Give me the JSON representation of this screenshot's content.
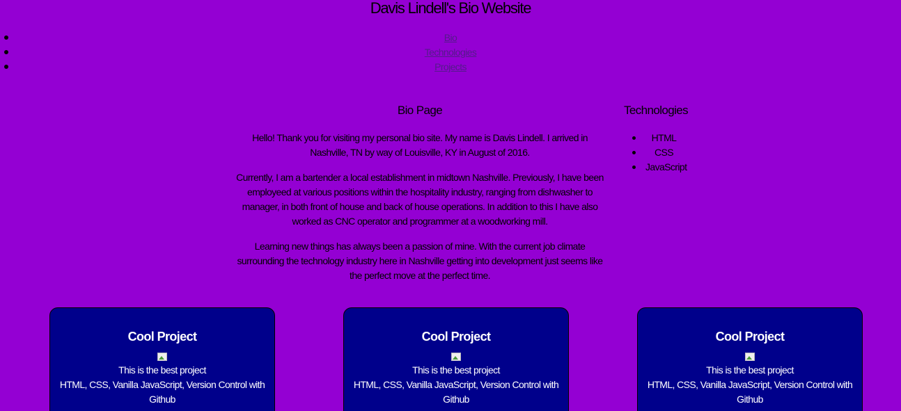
{
  "header": {
    "title": "Davis Lindell's Bio Website"
  },
  "nav": {
    "items": [
      {
        "label": "Bio"
      },
      {
        "label": "Technologies"
      },
      {
        "label": "Projects"
      }
    ]
  },
  "bio": {
    "heading": "Bio Page",
    "paragraphs": [
      "Hello! Thank you for visiting my personal bio site. My name is Davis Lindell. I arrived in Nashville, TN by way of Louisville, KY in August of 2016.",
      "Currently, I am a bartender a local establishment in midtown Nashville. Previously, I have been employeed at various positions within the hospitality industry, ranging from dishwasher to manager, in both front of house and back of house operations. In addition to this I have also worked as CNC operator and programmer at a woodworking mill.",
      "Learning new things has always been a passion of mine. With the current job climate surrounding the technology industry here in Nashville getting into development just seems like the perfect move at the perfect time."
    ]
  },
  "technologies": {
    "heading": "Technologies",
    "items": [
      "HTML",
      "CSS",
      "JavaScript"
    ]
  },
  "projects": [
    {
      "title": "Cool Project",
      "description": "This is the best project",
      "stack": "HTML, CSS, Vanilla JavaScript, Version Control with Github"
    },
    {
      "title": "Cool Project",
      "description": "This is the best project",
      "stack": "HTML, CSS, Vanilla JavaScript, Version Control with Github"
    },
    {
      "title": "Cool Project",
      "description": "This is the best project",
      "stack": "HTML, CSS, Vanilla JavaScript, Version Control with Github"
    }
  ],
  "colors": {
    "background": "#9400d3",
    "card_background": "#00008b",
    "link": "#551a8b"
  }
}
